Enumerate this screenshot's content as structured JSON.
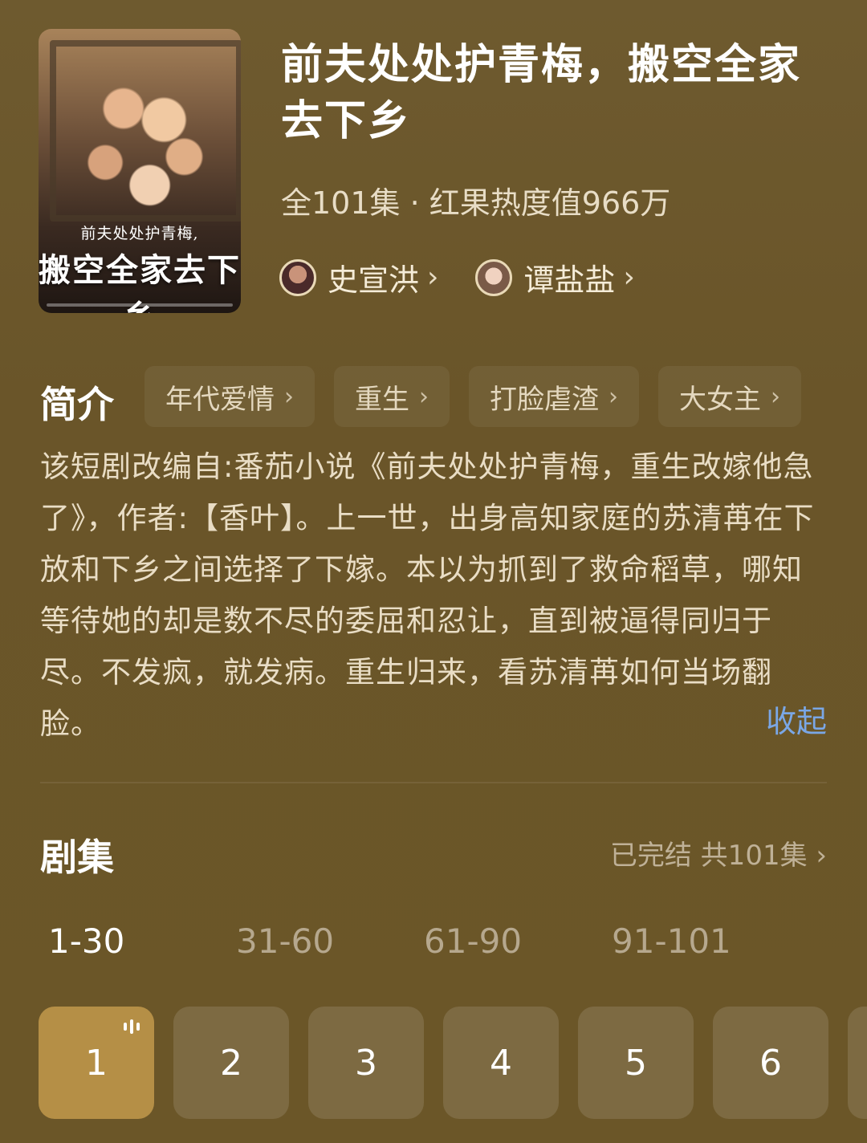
{
  "drama": {
    "poster": {
      "subtitle": "前夫处处护青梅,",
      "title": "搬空全家去下乡"
    },
    "title": "前夫处处护青梅，搬空全家去下乡",
    "meta": "全101集 · 红果热度值966万",
    "cast": [
      {
        "name": "史宣洪",
        "avatar": "avatar-male"
      },
      {
        "name": "谭盐盐",
        "avatar": "avatar-female"
      }
    ]
  },
  "intro": {
    "label": "简介",
    "tags": [
      "年代爱情",
      "重生",
      "打脸虐渣",
      "大女主"
    ],
    "synopsis": "该短剧改编自:番茄小说《前夫处处护青梅，重生改嫁他急了》，作者:【香叶】。上一世，出身高知家庭的苏清苒在下放和下乡之间选择了下嫁。本以为抓到了救命稻草，哪知等待她的却是数不尽的委屈和忍让，直到被逼得同归于尽。不发疯，就发病。重生归来，看苏清苒如何当场翻脸。",
    "collapse_label": "收起"
  },
  "episodes": {
    "label": "剧集",
    "status": "已完结 共101集",
    "ranges": [
      "1-30",
      "31-60",
      "61-90",
      "91-101"
    ],
    "active_range": 0,
    "tiles": [
      "1",
      "2",
      "3",
      "4",
      "5",
      "6"
    ],
    "active_episode": 0,
    "colors": {
      "active_tile": "#b58f46",
      "link": "#7aa7e6"
    }
  }
}
